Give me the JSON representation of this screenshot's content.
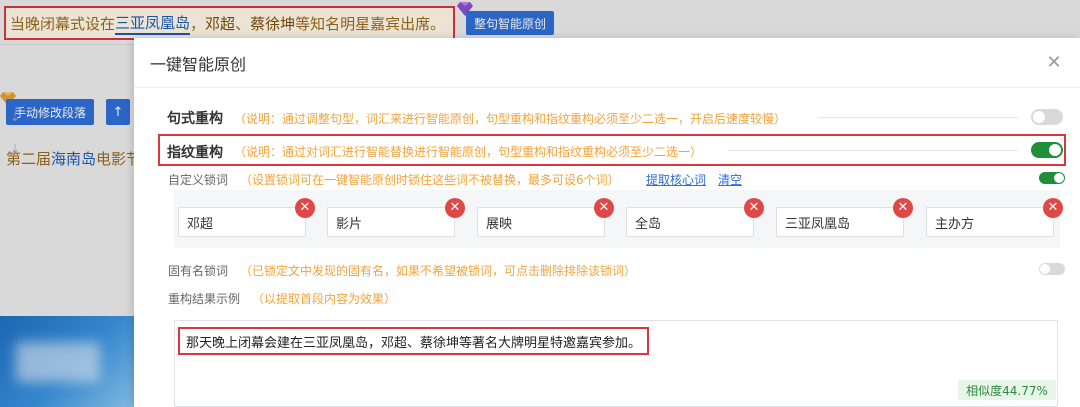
{
  "background": {
    "sentence_parts": [
      "当晚闭幕式设在",
      "三亚凤凰岛",
      "，",
      "邓超",
      "、",
      "蔡徐坤",
      "等",
      "知名明星嘉宾出席",
      "。"
    ],
    "whole_sentence_button": "整句智能原创",
    "manual_edit_button": "手动修改段落",
    "up_button": "↑",
    "line2_parts": [
      "第二届",
      "海南岛",
      "电影节"
    ]
  },
  "modal": {
    "title": "一键智能原创",
    "close_icon": "close-icon",
    "sentence_restructure": {
      "title": "句式重构",
      "desc": "（说明：通过调整句型，词汇来进行智能原创，句型重构和指纹重构必须至少二选一，开启后速度较慢）",
      "enabled": false
    },
    "fingerprint_restructure": {
      "title": "指纹重构",
      "desc": "（说明：通过对词汇进行智能替换进行智能原创，句型重构和指纹重构必须至少二选一）",
      "enabled": true
    },
    "custom_lock": {
      "label": "自定义锁词",
      "desc": "（设置锁词可在一键智能原创时锁住这些词不被替换，最多可设6个词）",
      "extract_link": "提取核心词",
      "clear_link": "清空",
      "enabled": true,
      "words": [
        "邓超",
        "影片",
        "展映",
        "全岛",
        "三亚凤凰岛",
        "主办方"
      ]
    },
    "proper_noun_lock": {
      "label": "固有名锁词",
      "desc": "（已锁定文中发现的固有名，如果不希望被锁词，可点击删除排除该锁词）",
      "enabled": false
    },
    "example": {
      "label": "重构结果示例",
      "desc": "（以提取首段内容为效果）",
      "text": "那天晚上闭幕会建在三亚凤凰岛，邓超、蔡徐坤等著名大牌明星特邀嘉宾参加。",
      "similarity": "相似度44.77%"
    }
  },
  "colors": {
    "accent": "#2f6fd8",
    "toggle_on": "#1f8f3a",
    "warning": "#f2a33a",
    "highlight_frame": "#d9363e"
  }
}
